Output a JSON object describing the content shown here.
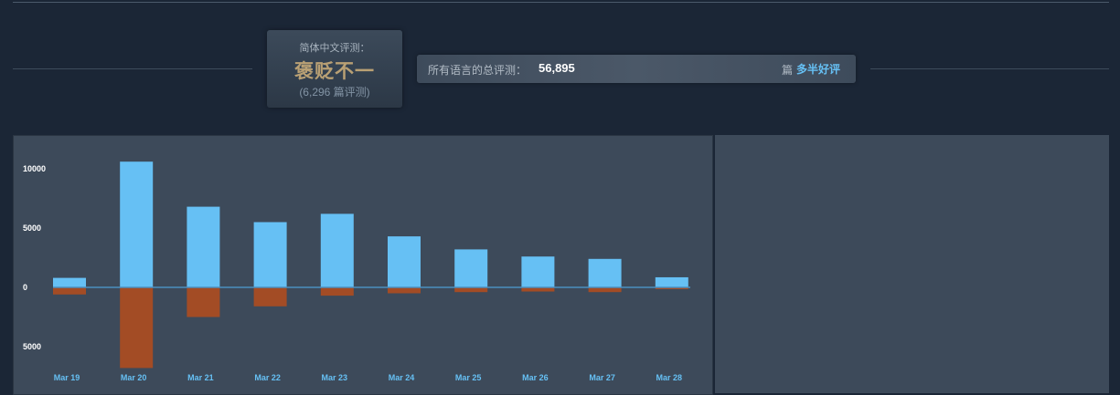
{
  "summary": {
    "label": "简体中文评测：",
    "rating": "褒贬不一",
    "count": "(6,296 篇评测)"
  },
  "all_languages": {
    "label": "所有语言的总评测：",
    "value": "56,895",
    "unit": "篇",
    "description": "多半好评"
  },
  "colors": {
    "positive": "#66c0f4",
    "negative": "#a34c25",
    "baseline": "#4b8fc0"
  },
  "chart_data": {
    "type": "bar",
    "categories": [
      "Mar 19",
      "Mar 20",
      "Mar 21",
      "Mar 22",
      "Mar 23",
      "Mar 24",
      "Mar 25",
      "Mar 26",
      "Mar 27",
      "Mar 28"
    ],
    "series": [
      {
        "values": [
          800,
          10600,
          6800,
          5500,
          6200,
          4300,
          3200,
          2600,
          2400,
          850
        ]
      },
      {
        "values": [
          -600,
          -6800,
          -2500,
          -1600,
          -700,
          -500,
          -400,
          -350,
          -400,
          -150
        ]
      }
    ],
    "yticks": [
      10000,
      5000,
      0,
      -5000
    ],
    "ytick_labels": [
      "10000",
      "5000",
      "0",
      "5000"
    ],
    "ylim": [
      -6800,
      10600
    ],
    "title": "",
    "xlabel": "",
    "ylabel": ""
  }
}
